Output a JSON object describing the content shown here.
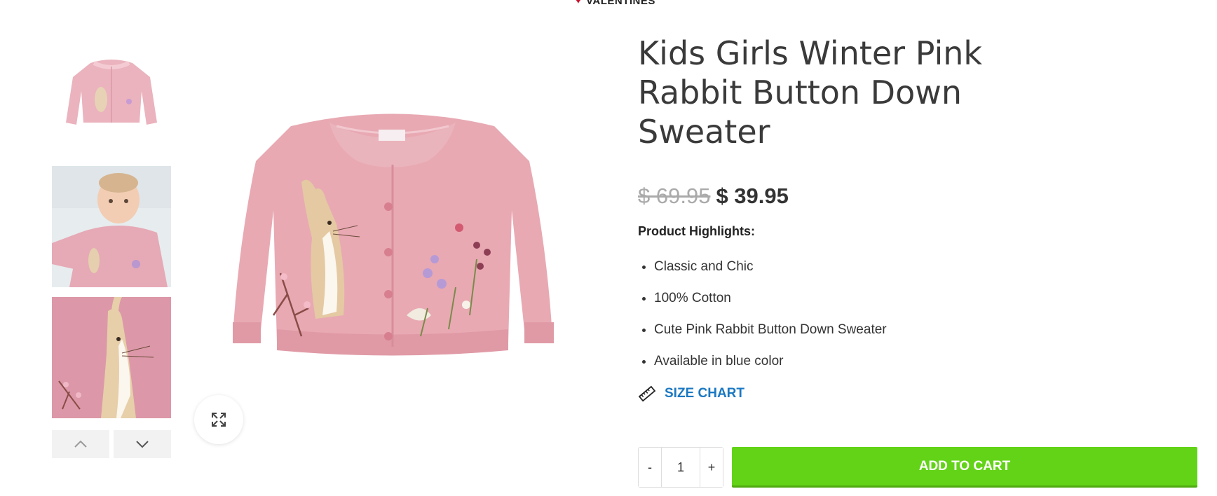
{
  "header": {
    "category_tag": "VALENTINES",
    "tag_icon": "heart-icon"
  },
  "gallery": {
    "thumbnails": [
      {
        "alt": "pink cardigan front"
      },
      {
        "alt": "baby wearing cardigan"
      },
      {
        "alt": "rabbit embroidery close-up"
      }
    ],
    "nav": {
      "prev_icon": "chevron-up-icon",
      "next_icon": "chevron-down-icon"
    },
    "zoom_icon": "expand-icon"
  },
  "product": {
    "title": "Kids Girls Winter Pink Rabbit Button Down Sweater",
    "old_price": "$ 69.95",
    "price": "$ 39.95",
    "highlights_label": "Product Highlights:",
    "highlights": [
      "Classic and Chic",
      "100% Cotton",
      "Cute Pink Rabbit Button Down Sweater",
      "Available in blue color"
    ],
    "size_chart_label": "SIZE CHART",
    "size_chart_icon": "ruler-icon"
  },
  "cart": {
    "minus_label": "-",
    "quantity": "1",
    "plus_label": "+",
    "add_to_cart_label": "ADD TO CART",
    "button_color": "#63d317"
  }
}
